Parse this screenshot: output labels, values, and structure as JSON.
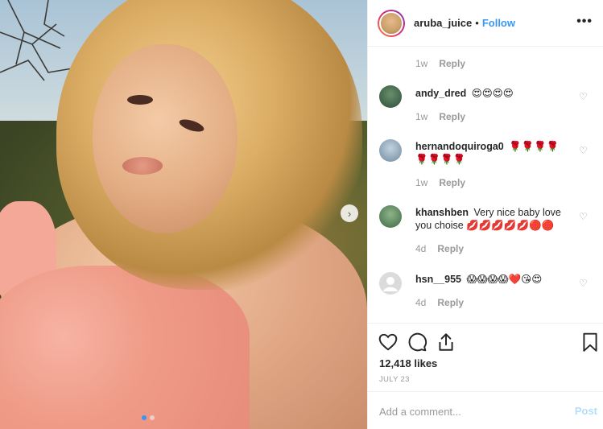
{
  "post": {
    "username": "aruba_juice",
    "separator": "•",
    "follow_label": "Follow",
    "more_label": "•••",
    "carousel_next": "›"
  },
  "top_comment_meta": {
    "time": "1w",
    "reply_label": "Reply"
  },
  "comments": [
    {
      "username": "andy_dred",
      "text": "😍😍😍😍",
      "time": "1w",
      "reply_label": "Reply",
      "avatar_color": "#3b6b49"
    },
    {
      "username": "hernandoquiroga0",
      "text": "🌹🌹🌹🌹🌹🌹🌹🌹",
      "time": "1w",
      "reply_label": "Reply",
      "avatar_color": "#8aa3b8"
    },
    {
      "username": "khanshben",
      "text": "Very nice baby love you choise 💋💋💋💋💋🔴🔴",
      "time": "4d",
      "reply_label": "Reply",
      "avatar_color": "#5f8a5a"
    },
    {
      "username": "hsn__955",
      "text": "😱😱😱😱❤️😘😍",
      "time": "4d",
      "reply_label": "Reply",
      "avatar_color": "#dbdbdb"
    }
  ],
  "actions": {
    "likes": "12,418 likes",
    "date": "JULY 23"
  },
  "add_comment": {
    "placeholder": "Add a comment...",
    "post_label": "Post"
  },
  "colors": {
    "link_blue": "#3897f0",
    "muted": "#999999",
    "post_disabled": "#b2dffc",
    "border": "#efefef"
  }
}
